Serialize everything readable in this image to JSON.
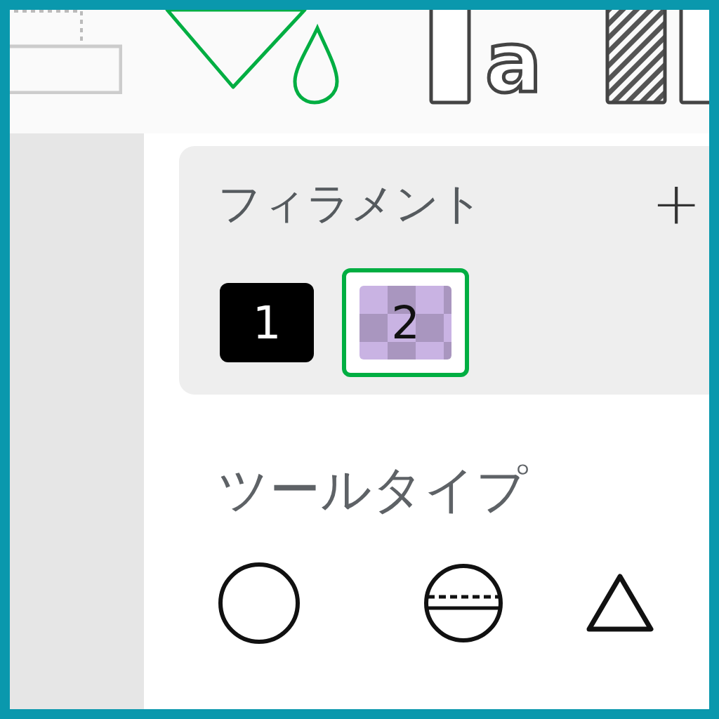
{
  "toolbar": {
    "tools": [
      {
        "kind": "select",
        "selected": false
      },
      {
        "kind": "paint",
        "selected": true
      },
      {
        "kind": "text",
        "label": "a",
        "selected": false
      },
      {
        "kind": "hatch",
        "selected": false
      }
    ]
  },
  "filament": {
    "title": "フィラメント",
    "add": "+",
    "items": [
      {
        "label": "1",
        "color": "#000000",
        "kind": "solid",
        "selected": false
      },
      {
        "label": "2",
        "color": "#c9b3e3",
        "kind": "translucent",
        "selected": true
      }
    ]
  },
  "tool_type": {
    "title": "ツールタイプ",
    "items": [
      {
        "kind": "circle"
      },
      {
        "kind": "sphere"
      },
      {
        "kind": "triangle"
      }
    ]
  }
}
